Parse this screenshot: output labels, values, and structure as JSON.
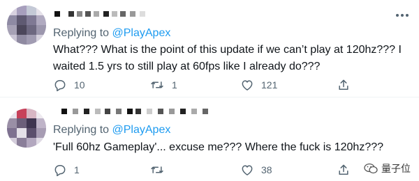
{
  "tweets": [
    {
      "replying_prefix": "Replying to ",
      "replying_handle": "@PlayApex",
      "text": "What??? What is the point of this update if we can’t play at 120hz??? I waited 1.5 yrs to still play at 60fps like I already do???",
      "reply_count": "10",
      "retweet_count": "1",
      "like_count": "121",
      "icons": [
        "reply-icon",
        "retweet-icon",
        "like-icon",
        "share-icon"
      ]
    },
    {
      "replying_prefix": "Replying to ",
      "replying_handle": "@PlayApex",
      "text": "'Full 60hz Gameplay'... excuse me??? Where the fuck is 120hz???",
      "reply_count": "1",
      "retweet_count": "",
      "like_count": "38",
      "icons": [
        "reply-icon",
        "retweet-icon",
        "like-icon",
        "share-icon"
      ]
    }
  ],
  "watermark": {
    "text": "量子位"
  },
  "colors": {
    "text": "#0f1419",
    "muted": "#536471",
    "link": "#1d9bf0",
    "divider": "#eff3f4"
  }
}
